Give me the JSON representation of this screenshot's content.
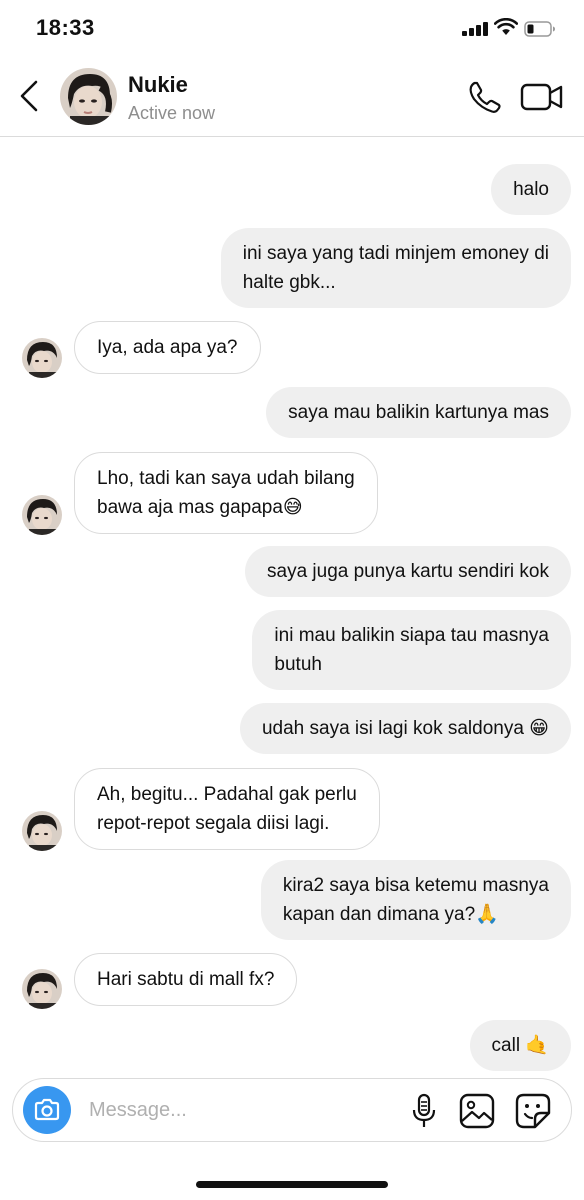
{
  "status_bar": {
    "time": "18:33"
  },
  "header": {
    "contact_name": "Nukie",
    "contact_status": "Active now"
  },
  "messages": [
    {
      "direction": "out",
      "text": "halo"
    },
    {
      "direction": "out",
      "lines": [
        "ini saya yang tadi minjem emoney di",
        "halte gbk..."
      ]
    },
    {
      "direction": "in",
      "text": "Iya, ada apa ya?"
    },
    {
      "direction": "out",
      "text": "saya mau balikin kartunya mas"
    },
    {
      "direction": "in",
      "lines": [
        "Lho, tadi kan saya udah bilang",
        "bawa aja mas gapapa😅"
      ]
    },
    {
      "direction": "out",
      "text": "saya juga punya kartu sendiri kok"
    },
    {
      "direction": "out",
      "lines": [
        "ini mau balikin siapa tau masnya",
        "butuh"
      ]
    },
    {
      "direction": "out",
      "text": "udah saya isi lagi kok saldonya 😁"
    },
    {
      "direction": "in",
      "lines": [
        "Ah, begitu... Padahal gak perlu",
        "repot-repot segala diisi lagi."
      ]
    },
    {
      "direction": "out",
      "lines": [
        "kira2 saya bisa ketemu masnya",
        "kapan dan dimana ya?🙏"
      ]
    },
    {
      "direction": "in",
      "text": "Hari sabtu di mall fx?"
    },
    {
      "direction": "out",
      "text": "call 🤙"
    }
  ],
  "composer": {
    "placeholder": "Message..."
  },
  "icons": {
    "back": "chevron-left-icon",
    "call": "phone-icon",
    "video": "video-camera-icon",
    "camera": "camera-icon",
    "mic": "microphone-icon",
    "gallery": "image-icon",
    "sticker": "sticker-icon"
  },
  "colors": {
    "accent": "#3897f0",
    "outgoing_bubble": "#efefef",
    "incoming_border": "#dbdbdb",
    "secondary_text": "#8e8e8e"
  }
}
